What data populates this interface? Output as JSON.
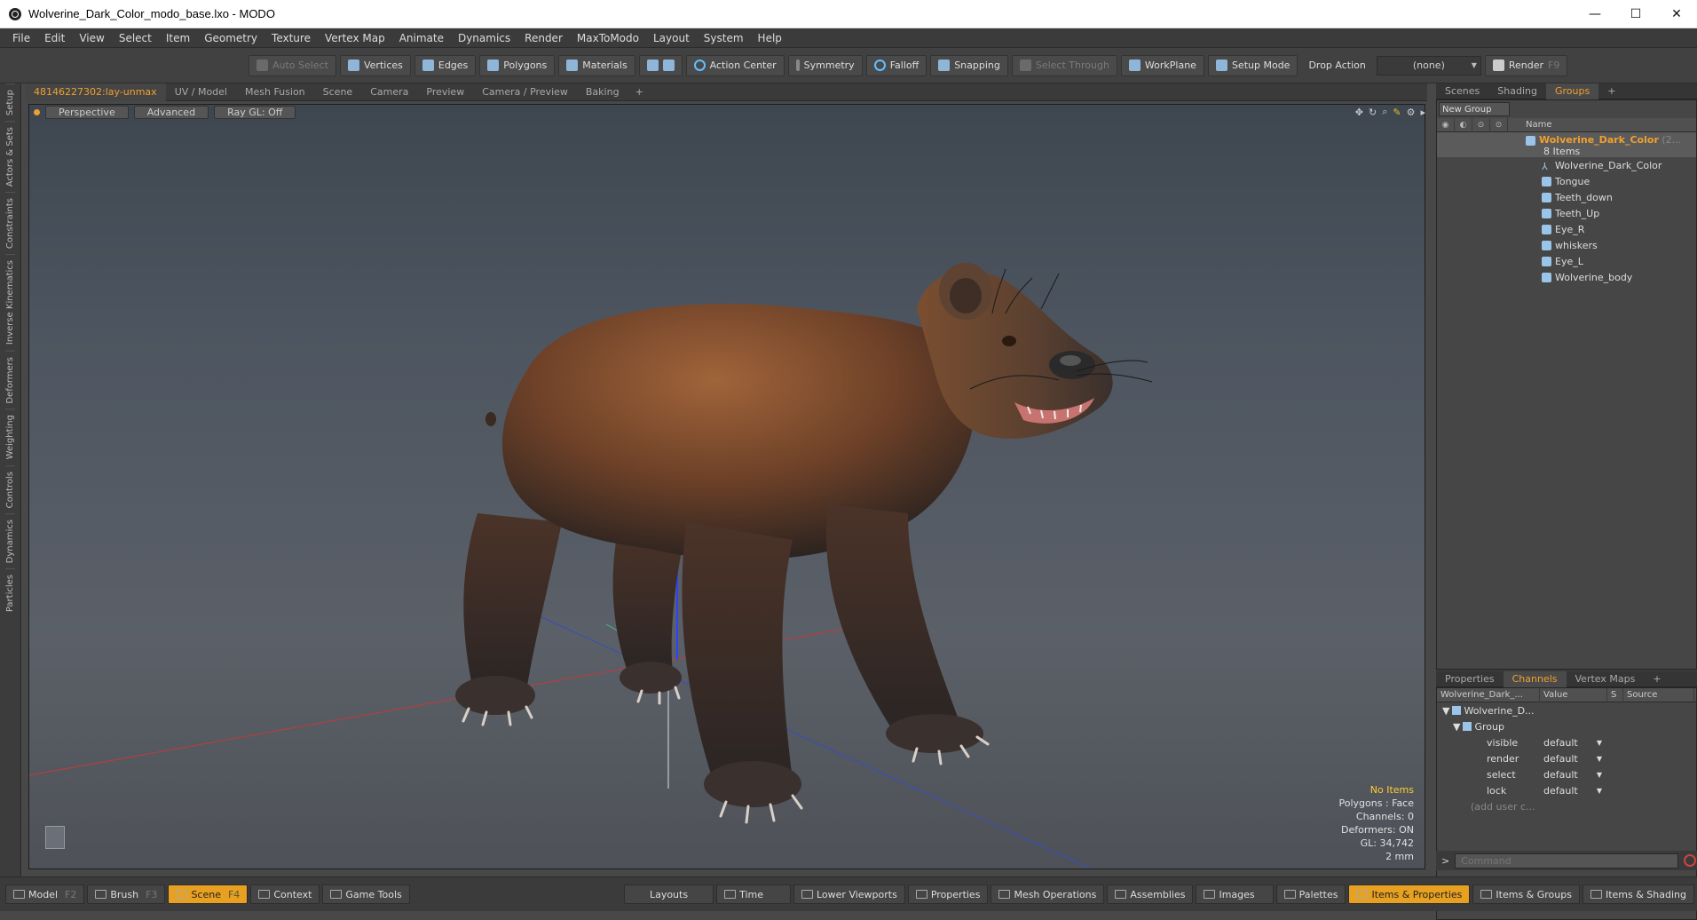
{
  "window": {
    "title": "Wolverine_Dark_Color_modo_base.lxo - MODO",
    "min": "—",
    "max": "☐",
    "close": "✕"
  },
  "menu": [
    "File",
    "Edit",
    "View",
    "Select",
    "Item",
    "Geometry",
    "Texture",
    "Vertex Map",
    "Animate",
    "Dynamics",
    "Render",
    "MaxToModo",
    "Layout",
    "System",
    "Help"
  ],
  "toolbar": {
    "auto_select": "Auto Select",
    "vertices": "Vertices",
    "edges": "Edges",
    "polygons": "Polygons",
    "materials": "Materials",
    "action_center": "Action Center",
    "symmetry": "Symmetry",
    "falloff": "Falloff",
    "snapping": "Snapping",
    "select_through": "Select Through",
    "workplane": "WorkPlane",
    "setup_mode": "Setup Mode",
    "drop_action": "Drop Action",
    "drop_value": "(none)",
    "render": "Render",
    "render_key": "F9"
  },
  "left_tabs": [
    "Setup",
    "Actors & Sets",
    "Constraints",
    "Inverse Kinematics",
    "Deformers",
    "Weighting",
    "Controls",
    "Dynamics",
    "Particles"
  ],
  "viewport_tabs": [
    "48146227302:lay-unmax",
    "UV / Model",
    "Mesh Fusion",
    "Scene",
    "Camera",
    "Preview",
    "Camera / Preview",
    "Baking"
  ],
  "viewport": {
    "perspective": "Perspective",
    "advanced": "Advanced",
    "raygl": "Ray GL: Off"
  },
  "stats": {
    "items": "No Items",
    "polygons": "Polygons : Face",
    "channels": "Channels: 0",
    "deformers": "Deformers: ON",
    "gl": "GL: 34,742",
    "scale": "2 mm"
  },
  "right_tabs": [
    "Scenes",
    "Shading",
    "Groups"
  ],
  "groups": {
    "new_group": "New Group",
    "name_header": "Name",
    "root": "Wolverine_Dark_Color",
    "root_suffix": "(2...",
    "count": "8 Items",
    "items": [
      "Wolverine_Dark_Color",
      "Tongue",
      "Teeth_down",
      "Teeth_Up",
      "Eye_R",
      "whiskers",
      "Eye_L",
      "Wolverine_body"
    ]
  },
  "props_tabs": [
    "Properties",
    "Channels",
    "Vertex Maps"
  ],
  "channels": {
    "col1": "Wolverine_Dark_...",
    "col_value": "Value",
    "col_s": "S",
    "col_source": "Source",
    "root": "Wolverine_D...",
    "group": "Group",
    "rows": [
      {
        "name": "visible",
        "value": "default"
      },
      {
        "name": "render",
        "value": "default"
      },
      {
        "name": "select",
        "value": "default"
      },
      {
        "name": "lock",
        "value": "default"
      }
    ],
    "add_user": "(add user c..."
  },
  "command": {
    "placeholder": "Command",
    "prompt": ">"
  },
  "bottom": {
    "model": "Model",
    "model_key": "F2",
    "brush": "Brush",
    "brush_key": "F3",
    "scene": "Scene",
    "scene_key": "F4",
    "context": "Context",
    "game_tools": "Game Tools",
    "layouts": "Layouts",
    "time": "Time",
    "lower_viewports": "Lower Viewports",
    "properties": "Properties",
    "mesh_ops": "Mesh Operations",
    "assemblies": "Assemblies",
    "images": "Images",
    "palettes": "Palettes",
    "items_props": "Items & Properties",
    "items_groups": "Items & Groups",
    "items_shading": "Items & Shading"
  }
}
